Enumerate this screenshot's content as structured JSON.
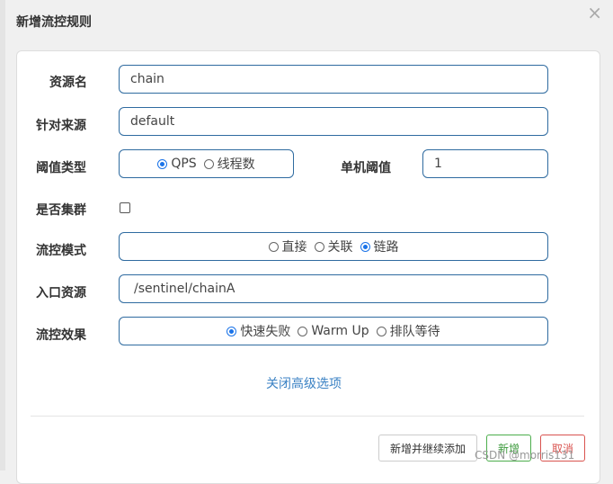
{
  "dialog": {
    "title": "新增流控规则"
  },
  "form": {
    "resource_name": {
      "label": "资源名",
      "value": "chain"
    },
    "limit_app": {
      "label": "针对来源",
      "value": "default"
    },
    "grade": {
      "label": "阈值类型",
      "options": [
        {
          "label": "QPS",
          "checked": true
        },
        {
          "label": "线程数",
          "checked": false
        }
      ]
    },
    "count": {
      "label": "单机阈值",
      "value": "1"
    },
    "cluster": {
      "label": "是否集群",
      "checked": false
    },
    "strategy": {
      "label": "流控模式",
      "options": [
        {
          "label": "直接",
          "checked": false
        },
        {
          "label": "关联",
          "checked": false
        },
        {
          "label": "链路",
          "checked": true
        }
      ]
    },
    "ref_resource": {
      "label": "入口资源",
      "value": "/sentinel/chainA"
    },
    "control_behavior": {
      "label": "流控效果",
      "options": [
        {
          "label": "快速失败",
          "checked": true
        },
        {
          "label": "Warm Up",
          "checked": false
        },
        {
          "label": "排队等待",
          "checked": false
        }
      ]
    },
    "advanced_toggle": "关闭高级选项"
  },
  "footer": {
    "add_continue": "新增并继续添加",
    "add": "新增",
    "cancel": "取消"
  },
  "watermark": "CSDN @morris131",
  "colors": {
    "field_border": "#2f6ba0",
    "radio_checked": "#1a73e8",
    "link": "#3b82c4",
    "success": "#3c9a3c",
    "danger": "#d9534f"
  }
}
